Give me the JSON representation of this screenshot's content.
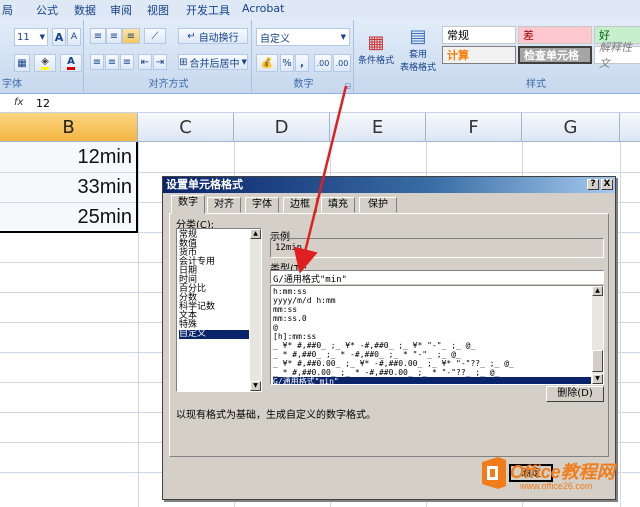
{
  "ribbon": {
    "tabs": [
      "局",
      "公式",
      "数据",
      "审阅",
      "视图",
      "开发工具",
      "Acrobat"
    ],
    "font_size": "11",
    "font_grow": "A",
    "font_shrink": "A",
    "wrap_text": "自动换行",
    "merge_center": "合并后居中",
    "number_format": "自定义",
    "percent_symbol": "%",
    "comma_symbol": ",",
    "inc_decimal": ".00",
    "dec_decimal": ".00",
    "conditional_format": "条件格式",
    "format_as_table_1": "套用",
    "format_as_table_2": "表格格式",
    "styles": {
      "normal": "常规",
      "bad": "差",
      "good": "好",
      "calc": "计算",
      "check_cell": "检查单元格",
      "explanatory": "解释性文"
    },
    "group_labels": {
      "font": "字体",
      "alignment": "对齐方式",
      "number": "数字",
      "styles": "样式"
    }
  },
  "formula_bar": {
    "fx": "fx",
    "value": "12"
  },
  "grid": {
    "columns": [
      "B",
      "C",
      "D",
      "E",
      "F",
      "G"
    ],
    "cells": [
      "12min",
      "33min",
      "25min"
    ]
  },
  "dialog": {
    "title": "设置单元格格式",
    "help_btn": "?",
    "close_btn": "X",
    "tabs": [
      "数字",
      "对齐",
      "字体",
      "边框",
      "填充",
      "保护"
    ],
    "category_label": "分类(C):",
    "categories": [
      "常规",
      "数值",
      "货币",
      "会计专用",
      "日期",
      "时间",
      "百分比",
      "分数",
      "科学记数",
      "文本",
      "特殊",
      "自定义"
    ],
    "selected_category": "自定义",
    "sample_label": "示例",
    "sample_value": "12min",
    "type_label": "类型(T):",
    "type_value": "G/通用格式\"min\"",
    "formats": [
      "h:mm:ss",
      "yyyy/m/d h:mm",
      "mm:ss",
      "mm:ss.0",
      "@",
      "[h]:mm:ss",
      "_ ¥* #,##0_ ;_ ¥* -#,##0_ ;_ ¥* \"-\"_ ;_ @_",
      "_ * #,##0_ ;_ * -#,##0_ ;_ * \"-\"_ ;_ @_",
      "_ ¥* #,##0.00_ ;_ ¥* -#,##0.00_ ;_ ¥* \"-\"??_ ;_ @_",
      "_ * #,##0.00_ ;_ * -#,##0.00_ ;_ * \"-\"??_ ;_ @_",
      "G/通用格式\"min\""
    ],
    "delete_btn": "删除(D)",
    "description": "以现有格式为基础，生成自定义的数字格式。",
    "ok_btn": "确定"
  },
  "watermark": {
    "brand": "Office教程网",
    "url": "www.office26.com"
  },
  "colors": {
    "accent_orange": "#f07d1a",
    "selection_blue": "#0a246a",
    "arrow_red": "#e02020"
  }
}
